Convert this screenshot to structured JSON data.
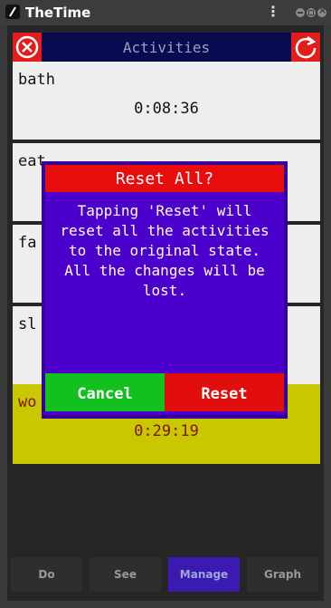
{
  "window": {
    "title": "TheTime",
    "menu_icon": "kebab-menu-icon"
  },
  "header": {
    "title": "Activities",
    "left_icon": "close-circle-icon",
    "right_icon": "reset-arrow-icon"
  },
  "activities": [
    {
      "name": "bath",
      "time": "0:08:36"
    },
    {
      "name": "eat",
      "time": ""
    },
    {
      "name": "fa",
      "time": ""
    },
    {
      "name": "sl",
      "time": ""
    },
    {
      "name": "wo",
      "time": "0:29:19",
      "active": true
    }
  ],
  "nav": {
    "items": [
      "Do",
      "See",
      "Manage",
      "Graph"
    ],
    "selected": "Manage"
  },
  "dialog": {
    "title": "Reset All?",
    "message": "Tapping 'Reset' will reset all the activities to the original state. All the changes will be lost.",
    "cancel_label": "Cancel",
    "reset_label": "Reset"
  },
  "colors": {
    "dialog_bg": "#4c00cc",
    "danger": "#e80d0d",
    "ok_green": "#12c01e",
    "active_row": "#c9c700",
    "header_bg": "#0a0a50"
  }
}
